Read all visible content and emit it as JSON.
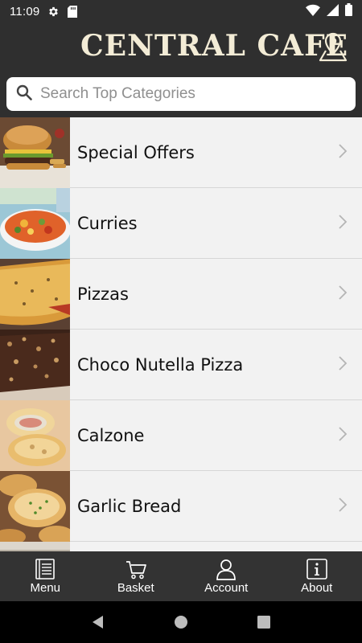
{
  "status_bar": {
    "time": "11:09",
    "icons": [
      "gear-icon",
      "sd-card-icon",
      "wifi-icon",
      "signal-icon",
      "battery-icon"
    ]
  },
  "header": {
    "title": "CENTRAL CAFE",
    "location_icon": "map-pin-icon"
  },
  "search": {
    "placeholder": "Search Top Categories",
    "value": ""
  },
  "categories": [
    {
      "label": "Special Offers"
    },
    {
      "label": "Curries"
    },
    {
      "label": "Pizzas"
    },
    {
      "label": "Choco Nutella Pizza"
    },
    {
      "label": "Calzone"
    },
    {
      "label": "Garlic Bread"
    }
  ],
  "bottom_nav": [
    {
      "label": "Menu",
      "icon": "menu-book-icon"
    },
    {
      "label": "Basket",
      "icon": "cart-icon"
    },
    {
      "label": "Account",
      "icon": "user-icon"
    },
    {
      "label": "About",
      "icon": "info-icon"
    }
  ],
  "colors": {
    "header_bg": "#2f2f2f",
    "brand_text": "#f3ecd6",
    "list_bg": "#f2f2f2",
    "nav_bg": "#333333"
  }
}
